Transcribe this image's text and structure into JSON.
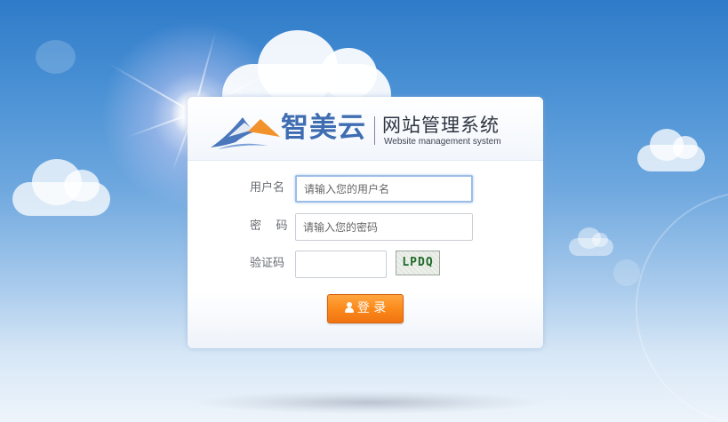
{
  "brand": {
    "name": "智美云",
    "title": "网站管理系统",
    "subtitle": "Website management system"
  },
  "form": {
    "username": {
      "label": "用户名",
      "placeholder": "请输入您的用户名",
      "value": ""
    },
    "password": {
      "label": "密    码",
      "placeholder": "请输入您的密码",
      "value": ""
    },
    "captcha": {
      "label": "验证码",
      "value": "",
      "image_text": "LPDQ"
    },
    "submit_label": "登 录"
  },
  "colors": {
    "brand_blue": "#3f6db2",
    "button_orange": "#fb8a1c",
    "sky_blue": "#4b92d5"
  }
}
